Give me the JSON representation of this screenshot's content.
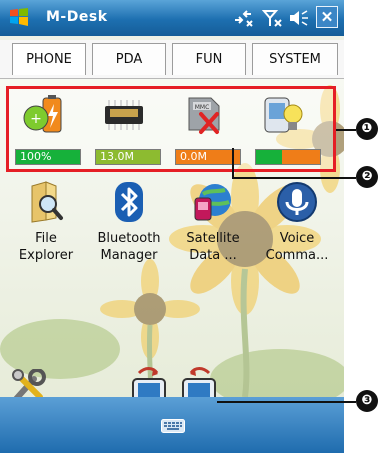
{
  "title_bar": {
    "app_title": "M-Desk",
    "close_glyph": "✕"
  },
  "tabs": [
    {
      "label": "PHONE"
    },
    {
      "label": "PDA"
    },
    {
      "label": "FUN"
    },
    {
      "label": "SYSTEM"
    }
  ],
  "status_items": [
    {
      "icon": "battery-icon",
      "value": "100%",
      "level": 1.0,
      "color": "#16b13a"
    },
    {
      "icon": "memory-chip-icon",
      "value": "13.0M",
      "level": 1.0,
      "color": "#8dbb30"
    },
    {
      "icon": "storage-card-missing-icon",
      "value": "0.0M",
      "level": 1.0,
      "color": "#ef7d18"
    },
    {
      "icon": "backlight-icon",
      "value": "",
      "level": 0.4,
      "color": "#16b13a",
      "rest_color": "#ef7d18"
    }
  ],
  "apps": [
    {
      "icon": "file-explorer-icon",
      "line1": "File",
      "line2": "Explorer"
    },
    {
      "icon": "bluetooth-icon",
      "line1": "Bluetooth",
      "line2": "Manager"
    },
    {
      "icon": "satellite-icon",
      "line1": "Satellite",
      "line2": "Data ..."
    },
    {
      "icon": "voice-command-icon",
      "line1": "Voice",
      "line2": "Comma..."
    }
  ],
  "callouts": [
    "❶",
    "❷",
    "❸"
  ],
  "colors": {
    "title_bar": "#1d6fb0",
    "highlight_border": "#e51e25",
    "bottom_bar": "#1f6cae"
  }
}
